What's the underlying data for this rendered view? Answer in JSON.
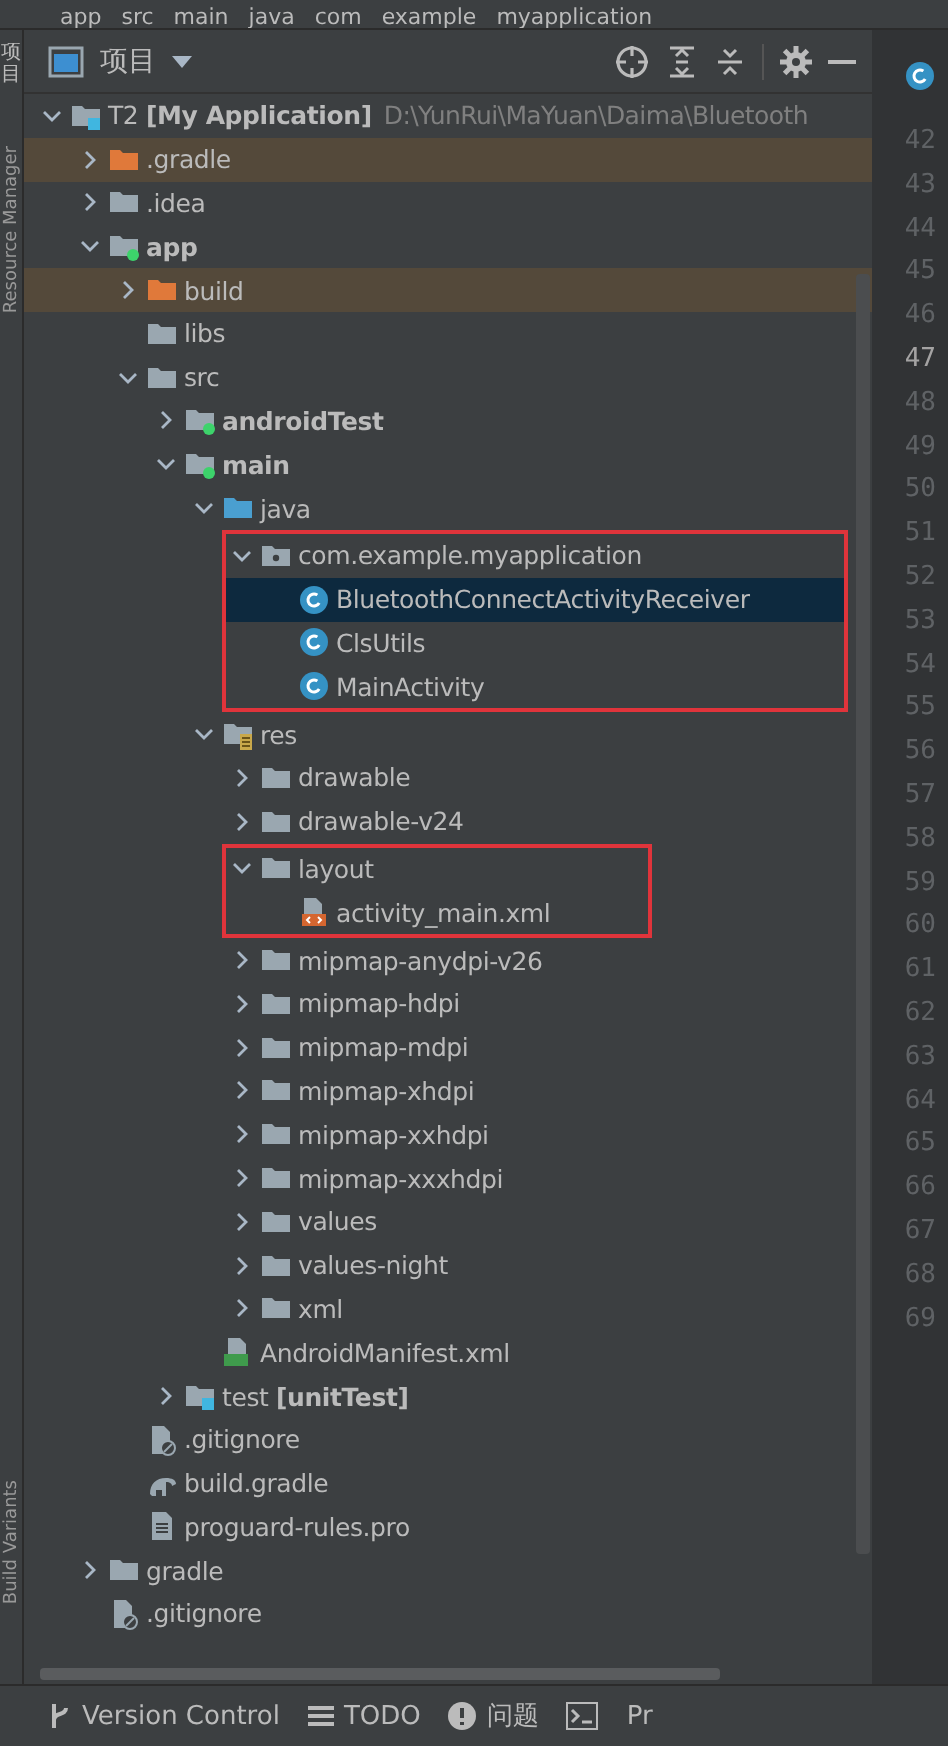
{
  "breadcrumbs": [
    "app",
    "src",
    "main",
    "java",
    "com",
    "example",
    "myapplication"
  ],
  "tool_strip": {
    "top": "项目",
    "labels": [
      "Resource Manager",
      "Build Variants"
    ]
  },
  "panel": {
    "title": "项目"
  },
  "tree": [
    {
      "label": "T2 **[My Application]**",
      "detail": "D:\\YunRui\\MaYuan\\Daima\\Bluetooth",
      "kind": "project",
      "expanded": true,
      "children": [
        {
          "label": ".gradle",
          "kind": "excluded",
          "expanded": false,
          "highlighted": true
        },
        {
          "label": ".idea",
          "kind": "folder",
          "expanded": false
        },
        {
          "label": "app",
          "kind": "module",
          "bold": true,
          "expanded": true,
          "children": [
            {
              "label": "build",
              "kind": "excluded",
              "expanded": false,
              "highlighted": true
            },
            {
              "label": "libs",
              "kind": "folder"
            },
            {
              "label": "src",
              "kind": "folder",
              "expanded": true,
              "children": [
                {
                  "label": "androidTest",
                  "kind": "module",
                  "bold": true,
                  "expanded": false
                },
                {
                  "label": "main",
                  "kind": "module",
                  "bold": true,
                  "expanded": true,
                  "children": [
                    {
                      "label": "java",
                      "kind": "source",
                      "expanded": true,
                      "children": [
                        {
                          "label": "com.example.myapplication",
                          "kind": "package",
                          "expanded": true,
                          "outlined": true,
                          "children": [
                            {
                              "label": "BluetoothConnectActivityReceiver",
                              "kind": "class",
                              "selected": true
                            },
                            {
                              "label": "ClsUtils",
                              "kind": "class",
                              "selected": false
                            },
                            {
                              "label": "MainActivity",
                              "kind": "class",
                              "selected": false
                            }
                          ]
                        }
                      ]
                    },
                    {
                      "label": "res",
                      "kind": "res",
                      "expanded": true,
                      "children": [
                        {
                          "label": "drawable",
                          "kind": "folder",
                          "expanded": false
                        },
                        {
                          "label": "drawable-v24",
                          "kind": "folder",
                          "expanded": false
                        },
                        {
                          "label": "layout",
                          "kind": "folder",
                          "expanded": true,
                          "outlined": true,
                          "children": [
                            {
                              "label": "activity_main.xml",
                              "kind": "layout-file"
                            }
                          ]
                        },
                        {
                          "label": "mipmap-anydpi-v26",
                          "kind": "folder",
                          "expanded": false
                        },
                        {
                          "label": "mipmap-hdpi",
                          "kind": "folder",
                          "expanded": false
                        },
                        {
                          "label": "mipmap-mdpi",
                          "kind": "folder",
                          "expanded": false
                        },
                        {
                          "label": "mipmap-xhdpi",
                          "kind": "folder",
                          "expanded": false
                        },
                        {
                          "label": "mipmap-xxhdpi",
                          "kind": "folder",
                          "expanded": false
                        },
                        {
                          "label": "mipmap-xxxhdpi",
                          "kind": "folder",
                          "expanded": false
                        },
                        {
                          "label": "values",
                          "kind": "folder",
                          "expanded": false
                        },
                        {
                          "label": "values-night",
                          "kind": "folder",
                          "expanded": false
                        },
                        {
                          "label": "xml",
                          "kind": "folder",
                          "expanded": false
                        }
                      ]
                    },
                    {
                      "label": "AndroidManifest.xml",
                      "kind": "manifest"
                    }
                  ]
                },
                {
                  "label": "test **[unitTest]**",
                  "kind": "test",
                  "expanded": false
                }
              ]
            },
            {
              "label": ".gitignore",
              "kind": "ignore"
            },
            {
              "label": "build.gradle",
              "kind": "gradle"
            },
            {
              "label": "proguard-rules.pro",
              "kind": "file"
            }
          ]
        },
        {
          "label": "gradle",
          "kind": "folder",
          "expanded": false
        },
        {
          "label": ".gitignore",
          "kind": "ignore"
        }
      ]
    }
  ],
  "line_numbers": [
    {
      "number": "42",
      "current": false
    },
    {
      "number": "43",
      "current": false
    },
    {
      "number": "44",
      "current": false
    },
    {
      "number": "45",
      "current": false
    },
    {
      "number": "46",
      "current": false
    },
    {
      "number": "47",
      "current": true
    },
    {
      "number": "48",
      "current": false
    },
    {
      "number": "49",
      "current": false
    },
    {
      "number": "50",
      "current": false
    },
    {
      "number": "51",
      "current": false
    },
    {
      "number": "52",
      "current": false
    },
    {
      "number": "53",
      "current": false
    },
    {
      "number": "54",
      "current": false
    },
    {
      "number": "55",
      "current": false
    },
    {
      "number": "56",
      "current": false
    },
    {
      "number": "57",
      "current": false
    },
    {
      "number": "58",
      "current": false
    },
    {
      "number": "59",
      "current": false
    },
    {
      "number": "60",
      "current": false
    },
    {
      "number": "61",
      "current": false
    },
    {
      "number": "62",
      "current": false
    },
    {
      "number": "63",
      "current": false
    },
    {
      "number": "64",
      "current": false
    },
    {
      "number": "65",
      "current": false
    },
    {
      "number": "66",
      "current": false
    },
    {
      "number": "67",
      "current": false
    },
    {
      "number": "68",
      "current": false
    },
    {
      "number": "69",
      "current": false
    }
  ],
  "bottom_tabs": [
    {
      "label": "Version Control",
      "kind": "vcs"
    },
    {
      "label": "TODO",
      "kind": "todo"
    },
    {
      "label": "问题",
      "kind": "problems"
    },
    {
      "kind": "terminal"
    },
    {
      "label": "Pr",
      "kind": "plain"
    }
  ]
}
